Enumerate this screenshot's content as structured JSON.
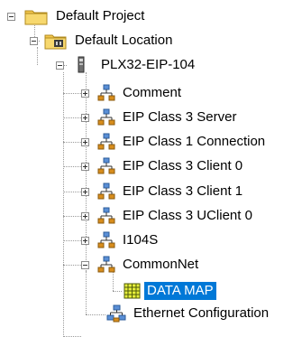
{
  "tree": {
    "project": {
      "label": "Default Project",
      "icon": "folder-icon",
      "expanded": true
    },
    "location": {
      "label": "Default Location",
      "icon": "folder-location-icon",
      "expanded": true
    },
    "device": {
      "label": "PLX32-EIP-104",
      "icon": "module-icon",
      "expanded": true
    },
    "items": [
      {
        "label": "Comment",
        "icon": "network-node-icon",
        "expanded": false
      },
      {
        "label": "EIP Class 3 Server",
        "icon": "network-node-icon",
        "expanded": false
      },
      {
        "label": "EIP Class 1 Connection",
        "icon": "network-node-icon",
        "expanded": false
      },
      {
        "label": "EIP Class 3 Client 0",
        "icon": "network-node-icon",
        "expanded": false
      },
      {
        "label": "EIP Class 3 Client 1",
        "icon": "network-node-icon",
        "expanded": false
      },
      {
        "label": "EIP Class 3 UClient 0",
        "icon": "network-node-icon",
        "expanded": false
      },
      {
        "label": "I104S",
        "icon": "network-node-icon",
        "expanded": false
      },
      {
        "label": "CommonNet",
        "icon": "network-node-icon",
        "expanded": true
      }
    ],
    "data_map": {
      "label": "DATA MAP",
      "icon": "grid-table-icon",
      "selected": true
    },
    "ethernet": {
      "label": "Ethernet Configuration",
      "icon": "ethernet-network-icon"
    }
  },
  "colors": {
    "selection": "#0078d7",
    "folder": "#f3c74d",
    "network_icon": "#d88d1c",
    "grid_icon": "#c8d400"
  }
}
